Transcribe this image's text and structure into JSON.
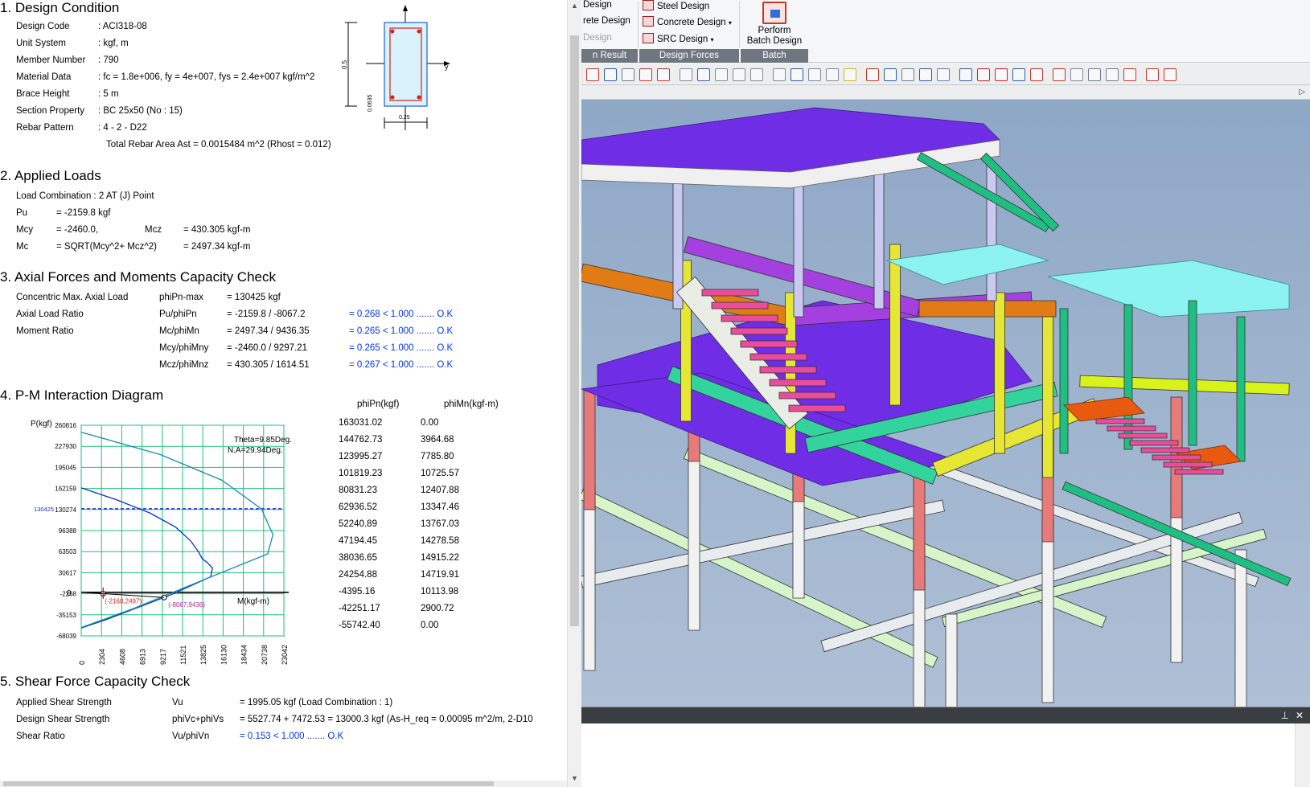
{
  "report": {
    "s1": {
      "title": "1. Design Condition",
      "rows": [
        {
          "label": "Design Code",
          "value": ":  ACI318-08"
        },
        {
          "label": "Unit System",
          "value": ":  kgf, m"
        },
        {
          "label": "Member Number",
          "value": ":  790"
        },
        {
          "label": "Material Data",
          "value": ":  fc = 1.8e+006,   fy = 4e+007,   fys = 2.4e+007 kgf/m^2"
        },
        {
          "label": "Brace Height",
          "value": ":  5 m"
        },
        {
          "label": "Section Property",
          "value": ":  BC 25x50 (No : 15)"
        },
        {
          "label": "Rebar Pattern",
          "value": ":  4 - 2 - D22"
        }
      ],
      "total_rebar": "Total Rebar Area   Ast = 0.0015484 m^2   (Rhost = 0.012)",
      "section": {
        "dim_h": "0.5",
        "dim_w": "0.25",
        "dim_c": "0.0635",
        "axis_y": "y"
      }
    },
    "s2": {
      "title": "2. Applied Loads",
      "load_combo": "Load Combination :    2    AT (J) Point",
      "pu_l": "Pu",
      "pu_v": "= -2159.8 kgf",
      "mcy_l": "Mcy",
      "mcy_v": "= -2460.0,",
      "mcz_l": "Mcz",
      "mcz_v": "= 430.305 kgf-m",
      "mc_l": "Mc",
      "mc_v": "= SQRT(Mcy^2+ Mcz^2)",
      "mc_r": "= 2497.34 kgf-m"
    },
    "s3": {
      "title": "3. Axial Forces and Moments Capacity Check",
      "rows": [
        {
          "label": "Concentric Max. Axial Load",
          "sym": "phiPn-max",
          "calc": "=   130425  kgf",
          "check": ""
        },
        {
          "label": "Axial Load Ratio",
          "sym": "Pu/phiPn",
          "calc": "= -2159.8 / -8067.2",
          "check": "= 0.268  < 1.000 ....... O.K"
        },
        {
          "label": "Moment Ratio",
          "sym": "Mc/phiMn",
          "calc": "= 2497.34 / 9436.35",
          "check": "= 0.265  < 1.000 ....... O.K"
        },
        {
          "label": "",
          "sym": "Mcy/phiMny",
          "calc": "= -2460.0 / 9297.21",
          "check": "= 0.265  < 1.000 ....... O.K"
        },
        {
          "label": "",
          "sym": "Mcz/phiMnz",
          "calc": "= 430.305 / 1614.51",
          "check": "= 0.267  < 1.000 ....... O.K"
        }
      ]
    },
    "s4": {
      "title": "4. P-M Interaction Diagram",
      "col1": "phiPn(kgf)",
      "col2": "phiMn(kgf-m)",
      "table": [
        [
          "163031.02",
          "0.00"
        ],
        [
          "144762.73",
          "3964.68"
        ],
        [
          "123995.27",
          "7785.80"
        ],
        [
          "101819.23",
          "10725.57"
        ],
        [
          "80831.23",
          "12407.88"
        ],
        [
          "62936.52",
          "13347.46"
        ],
        [
          "52240.89",
          "13767.03"
        ],
        [
          "47194.45",
          "14278.58"
        ],
        [
          "38036.65",
          "14915.22"
        ],
        [
          "24254.88",
          "14719.91"
        ],
        [
          "-4395.16",
          "10113.98"
        ],
        [
          "-42251.17",
          "2900.72"
        ],
        [
          "-55742.40",
          "0.00"
        ]
      ]
    },
    "s5": {
      "title": "5. Shear Force Capacity Check",
      "rows": [
        {
          "label": "Applied Shear Strength",
          "sym": "Vu",
          "calc": "= 1995.05  kgf  (Load Combination :    1)"
        },
        {
          "label": "Design Shear Strength",
          "sym": "phiVc+phiVs",
          "calc": "= 5527.74 + 7472.53 = 13000.3  kgf  (As-H_req  = 0.00095 m^2/m,  2-D10"
        },
        {
          "label": "Shear Ratio",
          "sym": "Vu/phiVn",
          "calc": "= 0.153  < 1.000 ....... O.K"
        }
      ]
    }
  },
  "chart_data": {
    "type": "line",
    "xlabel": "M(kgf-m)",
    "ylabel": "P(kgf)",
    "x_ticks": [
      "0",
      "2304",
      "4608",
      "6913",
      "9217",
      "11521",
      "13825",
      "16130",
      "18434",
      "20738",
      "23042"
    ],
    "y_ticks": [
      "260816",
      "227930",
      "195045",
      "162159",
      "130274",
      "96388",
      "63503",
      "30617",
      "-2268",
      "-35153",
      "-68039"
    ],
    "xlim": [
      0,
      23042
    ],
    "ylim": [
      -68039,
      260816
    ],
    "annotations": [
      "Theta=9.85Deg.",
      "N.A=29.94Deg."
    ],
    "ref_line": {
      "label": "130425",
      "y": 130425
    },
    "points": [
      {
        "label": "(-2160,2497)",
        "x": 2497,
        "y": -2160
      },
      {
        "label": "(-8067,9436)",
        "x": 9436,
        "y": -8067
      }
    ],
    "series": [
      {
        "color": "#0033cc",
        "x": [
          0,
          3964.68,
          7785.8,
          10725.57,
          12407.88,
          13347.46,
          13767.03,
          14278.58,
          14915.22,
          14719.91,
          10113.98,
          2900.72,
          0
        ],
        "y": [
          163031.02,
          144762.73,
          123995.27,
          101819.23,
          80831.23,
          62936.52,
          52240.89,
          47194.45,
          38036.65,
          24254.88,
          -4395.16,
          -42251.17,
          -55742.4
        ]
      },
      {
        "color": "#1a8caa",
        "x": [
          0,
          9000,
          16000,
          20500,
          21800,
          21200,
          14000,
          6000,
          0
        ],
        "y": [
          250000,
          215000,
          175000,
          130000,
          90000,
          60000,
          20000,
          -25000,
          -55000
        ]
      }
    ]
  },
  "app": {
    "ribbon": {
      "left_items": [
        "Design",
        "rete Design",
        "Design"
      ],
      "mid_items": [
        "Steel Design",
        "Concrete Design",
        "SRC Design"
      ],
      "batch_label1": "Perform",
      "batch_label2": "Batch Design",
      "groups": [
        "n Result",
        "Design Forces",
        "Batch"
      ]
    },
    "accent": "#6f7680"
  }
}
